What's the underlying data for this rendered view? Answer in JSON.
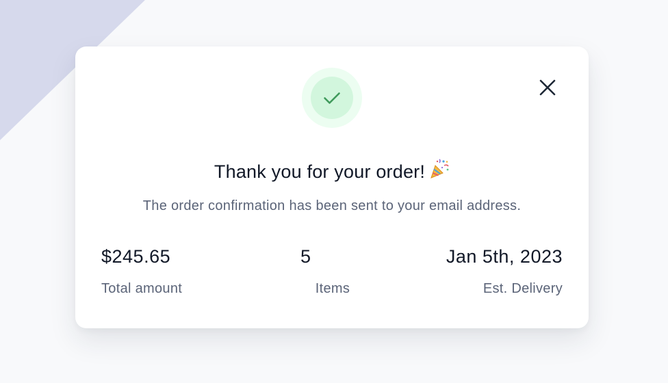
{
  "modal": {
    "status_icon": "check-icon",
    "close_icon": "close-icon",
    "title": "Thank you for your order!",
    "title_emoji": "party-popper-icon",
    "subtitle": "The order confirmation has been sent to your email address."
  },
  "summary": {
    "total_amount": {
      "value": "$245.65",
      "label": "Total amount"
    },
    "items": {
      "value": "5",
      "label": "Items"
    },
    "delivery": {
      "value": "Jan 5th, 2023",
      "label": "Est. Delivery"
    }
  },
  "colors": {
    "success_ring": "#ecfdf1",
    "success_inner": "#d2f6dd",
    "success_check": "#3f9a5b",
    "background_accent": "#d6d9ec",
    "text_primary": "#111827",
    "text_secondary": "#5b6478"
  }
}
